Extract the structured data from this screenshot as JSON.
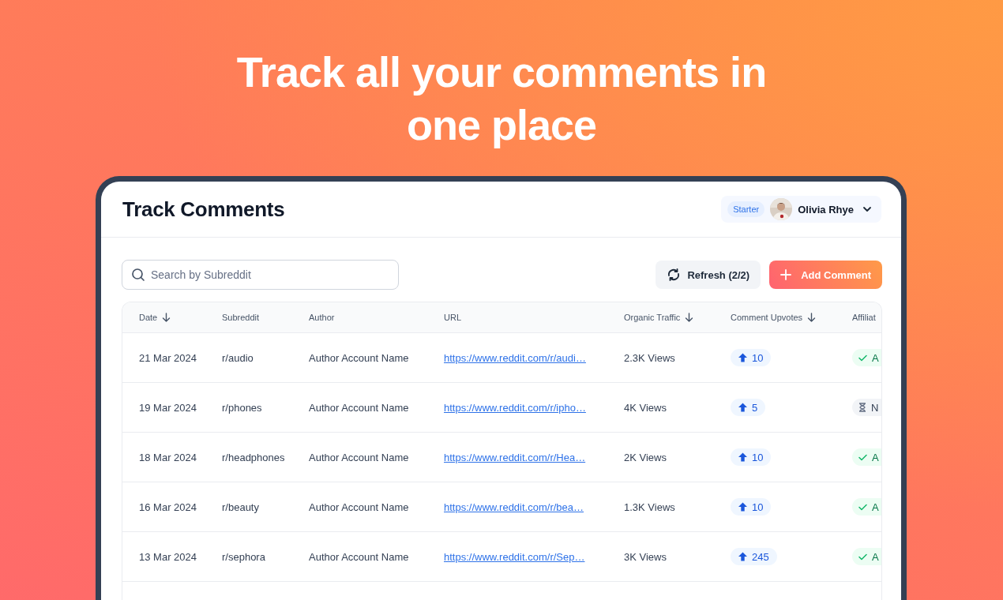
{
  "headline_lines": [
    "Track all your comments in",
    "one place"
  ],
  "app": {
    "title": "Track Comments",
    "plan_badge": "Starter",
    "user": {
      "name": "Olivia Rhye"
    }
  },
  "toolbar": {
    "search": {
      "placeholder": "Search by Subreddit"
    },
    "refresh_button": "Refresh (2/2)",
    "add_button": "Add Comment"
  },
  "table": {
    "columns": [
      {
        "label": "Date",
        "sort_arrow": true
      },
      {
        "label": "Subreddit",
        "sort_arrow": false
      },
      {
        "label": "Author",
        "sort_arrow": false
      },
      {
        "label": "URL",
        "sort_arrow": false
      },
      {
        "label": "Organic Traffic",
        "sort_arrow": true
      },
      {
        "label": "Comment Upvotes",
        "sort_arrow": true
      },
      {
        "label": "Affiliat",
        "sort_arrow": false
      }
    ],
    "rows": [
      {
        "date": "21 Mar 2024",
        "subreddit": "r/audio",
        "author": "Author Account Name",
        "url": "https://www.reddit.com/r/audi…",
        "traffic": "2.3K Views",
        "upvotes": "10",
        "status": {
          "kind": "active",
          "label": "A"
        }
      },
      {
        "date": "19 Mar 2024",
        "subreddit": "r/phones",
        "author": "Author Account Name",
        "url": "https://www.reddit.com/r/ipho…",
        "traffic": "4K Views",
        "upvotes": "5",
        "status": {
          "kind": "pending",
          "label": "N"
        }
      },
      {
        "date": "18 Mar 2024",
        "subreddit": "r/headphones",
        "author": "Author Account Name",
        "url": "https://www.reddit.com/r/Hea…",
        "traffic": "2K Views",
        "upvotes": "10",
        "status": {
          "kind": "active",
          "label": "A"
        }
      },
      {
        "date": "16 Mar 2024",
        "subreddit": "r/beauty",
        "author": "Author Account Name",
        "url": "https://www.reddit.com/r/bea…",
        "traffic": "1.3K Views",
        "upvotes": "10",
        "status": {
          "kind": "active",
          "label": "A"
        }
      },
      {
        "date": "13 Mar 2024",
        "subreddit": "r/sephora",
        "author": "Author Account Name",
        "url": "https://www.reddit.com/r/Sep…",
        "traffic": "3K Views",
        "upvotes": "245",
        "status": {
          "kind": "active",
          "label": "A"
        }
      }
    ]
  }
}
